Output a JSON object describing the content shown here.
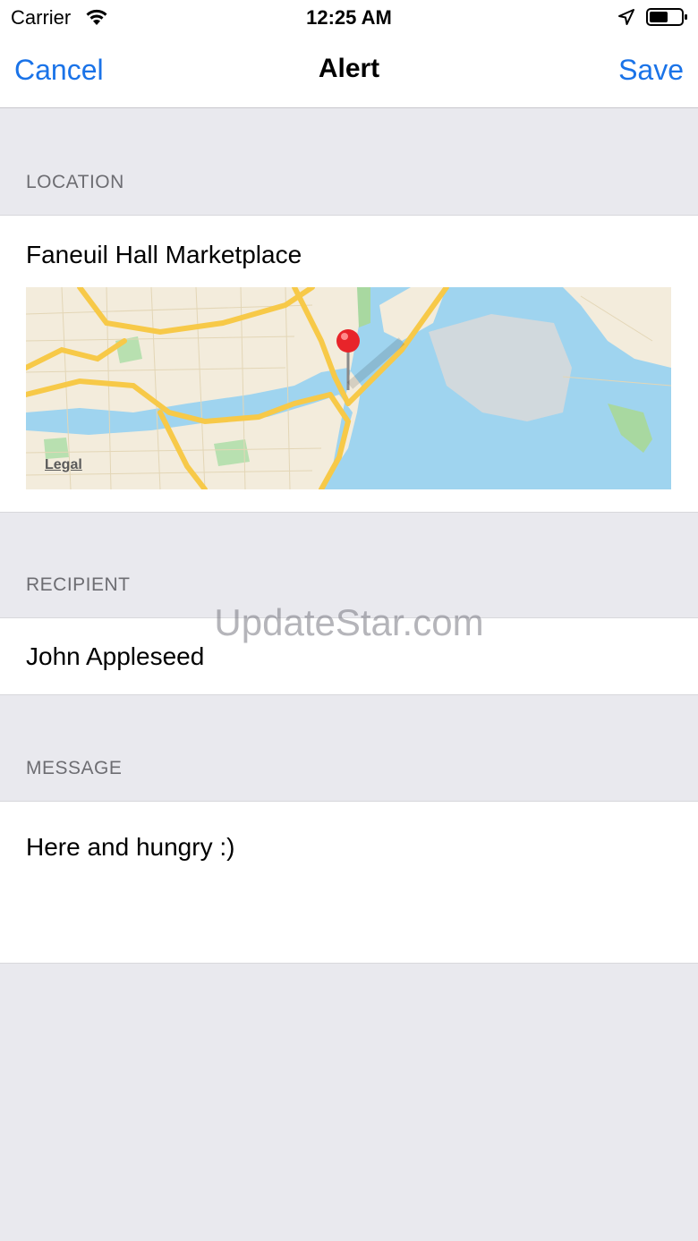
{
  "status_bar": {
    "carrier": "Carrier",
    "time": "12:25 AM",
    "icons": [
      "wifi-icon",
      "location-arrow-icon",
      "battery-icon"
    ]
  },
  "nav": {
    "cancel_label": "Cancel",
    "title": "Alert",
    "save_label": "Save",
    "accent_color": "#1a73e8"
  },
  "sections": {
    "location": {
      "header": "LOCATION",
      "value": "Faneuil Hall Marketplace",
      "map_legal": "Legal"
    },
    "recipient": {
      "header": "RECIPIENT",
      "value": "John Appleseed"
    },
    "message": {
      "header": "MESSAGE",
      "value": "Here and hungry :)"
    }
  },
  "watermark": "UpdateStar.com",
  "colors": {
    "background": "#e9e9ee",
    "pin": "#e8242a",
    "water": "#9fd4ef",
    "road": "#f7c948"
  }
}
